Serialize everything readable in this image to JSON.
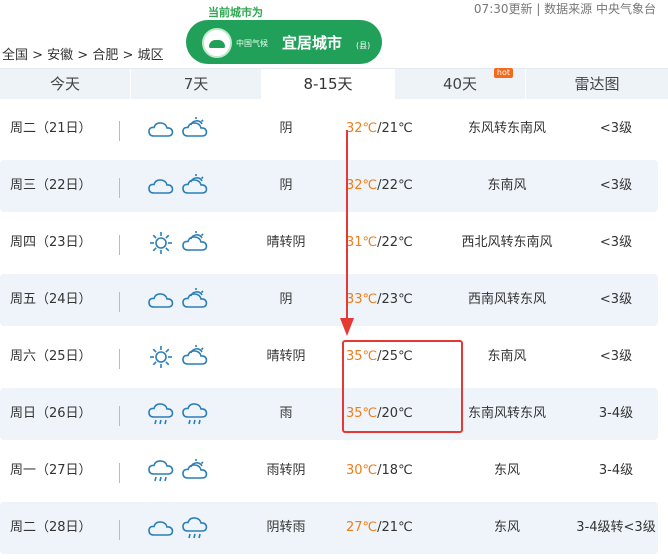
{
  "header": {
    "update_text": "07:30更新 | 数据来源 中央气象台",
    "breadcrumb": "全国 > 安徽 > 合肥 > 城区",
    "banner": {
      "tagline": "当前城市为",
      "sub_text": "中国气候",
      "main_text": "宜居城市",
      "paren_text": "(县)"
    }
  },
  "tabs": [
    {
      "label": "今天"
    },
    {
      "label": "7天"
    },
    {
      "label": "8-15天",
      "active": true
    },
    {
      "label": "40天",
      "badge": "hot"
    },
    {
      "label": "雷达图"
    }
  ],
  "forecast": [
    {
      "day": "周二（21日）",
      "icons": [
        "cloudy-icon",
        "partly-cloudy-icon"
      ],
      "desc": "阴",
      "high": "32℃",
      "low": "/21℃",
      "wind": "东风转东南风",
      "level": "<3级"
    },
    {
      "day": "周三（22日）",
      "icons": [
        "cloudy-icon",
        "partly-cloudy-icon"
      ],
      "desc": "阴",
      "high": "32℃",
      "low": "/22℃",
      "wind": "东南风",
      "level": "<3级"
    },
    {
      "day": "周四（23日）",
      "icons": [
        "sunny-icon",
        "partly-cloudy-icon"
      ],
      "desc": "晴转阴",
      "high": "31℃",
      "low": "/22℃",
      "wind": "西北风转东南风",
      "level": "<3级"
    },
    {
      "day": "周五（24日）",
      "icons": [
        "cloudy-icon",
        "partly-cloudy-icon"
      ],
      "desc": "阴",
      "high": "33℃",
      "low": "/23℃",
      "wind": "西南风转东风",
      "level": "<3级"
    },
    {
      "day": "周六（25日）",
      "icons": [
        "sunny-icon",
        "partly-cloudy-icon"
      ],
      "desc": "晴转阴",
      "high": "35℃",
      "low": "/25℃",
      "wind": "东南风",
      "level": "<3级"
    },
    {
      "day": "周日（26日）",
      "icons": [
        "rain-icon",
        "rain-icon"
      ],
      "desc": "雨",
      "high": "35℃",
      "low": "/20℃",
      "wind": "东南风转东风",
      "level": "3-4级"
    },
    {
      "day": "周一（27日）",
      "icons": [
        "rain-icon",
        "partly-cloudy-icon"
      ],
      "desc": "雨转阴",
      "high": "30℃",
      "low": "/18℃",
      "wind": "东风",
      "level": "3-4级"
    },
    {
      "day": "周二（28日）",
      "icons": [
        "cloudy-icon",
        "rain-icon"
      ],
      "desc": "阴转雨",
      "high": "27℃",
      "low": "/21℃",
      "wind": "东风",
      "level": "3-4级转<3级"
    }
  ],
  "colors": {
    "accent_green": "#21a05a",
    "high_temp": "#f07d1a",
    "highlight_red": "#e53935",
    "icon_blue": "#2c7fb8"
  }
}
